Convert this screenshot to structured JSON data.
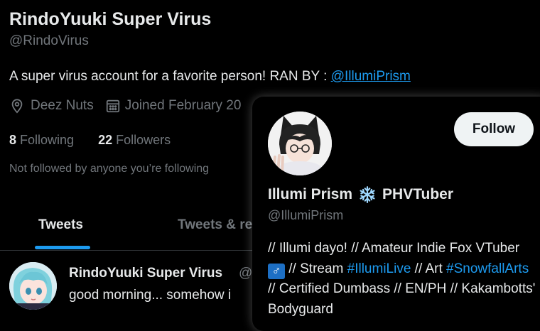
{
  "profile": {
    "name": "RindoYuuki Super Virus",
    "handle": "@RindoVirus",
    "bio_text": "A super virus account for a favorite person! RAN BY : ",
    "bio_mention": "@IllumiPrism",
    "location": "Deez Nuts",
    "joined": "Joined February 20",
    "following_count": "8",
    "following_label": "Following",
    "followers_count": "22",
    "followers_label": "Followers",
    "not_followed": "Not followed by anyone you’re following"
  },
  "tabs": [
    {
      "label": "Tweets",
      "active": true
    },
    {
      "label": "Tweets & re",
      "active": false
    }
  ],
  "tweet": {
    "author_name": "RindoYuuki Super Virus",
    "author_handle": "@",
    "text": "good morning... somehow i"
  },
  "popup": {
    "follow_label": "Follow",
    "name": "Illumi Prism",
    "name_emoji": "❄️",
    "name_suffix": "PHVTuber",
    "handle": "@IllumiPrism",
    "bio_part1": "// Illumi dayo! // Amateur Indie Fox VTuber ",
    "bio_male": "♂",
    "bio_part2": " // Stream ",
    "bio_tag1": "#IllumiLive",
    "bio_part3": " // Art ",
    "bio_tag2": "#SnowfallArts",
    "bio_part4": " // Certified Dumbass // EN/PH // Kakambotts' Bodyguard"
  },
  "colors": {
    "background": "#000000",
    "text": "#e7e9ea",
    "muted": "#71767b",
    "accent": "#1d9bf0",
    "follow_button": "#eff3f4"
  },
  "icons": [
    "location-icon",
    "calendar-icon",
    "snowflake-icon",
    "male-sign-icon"
  ]
}
